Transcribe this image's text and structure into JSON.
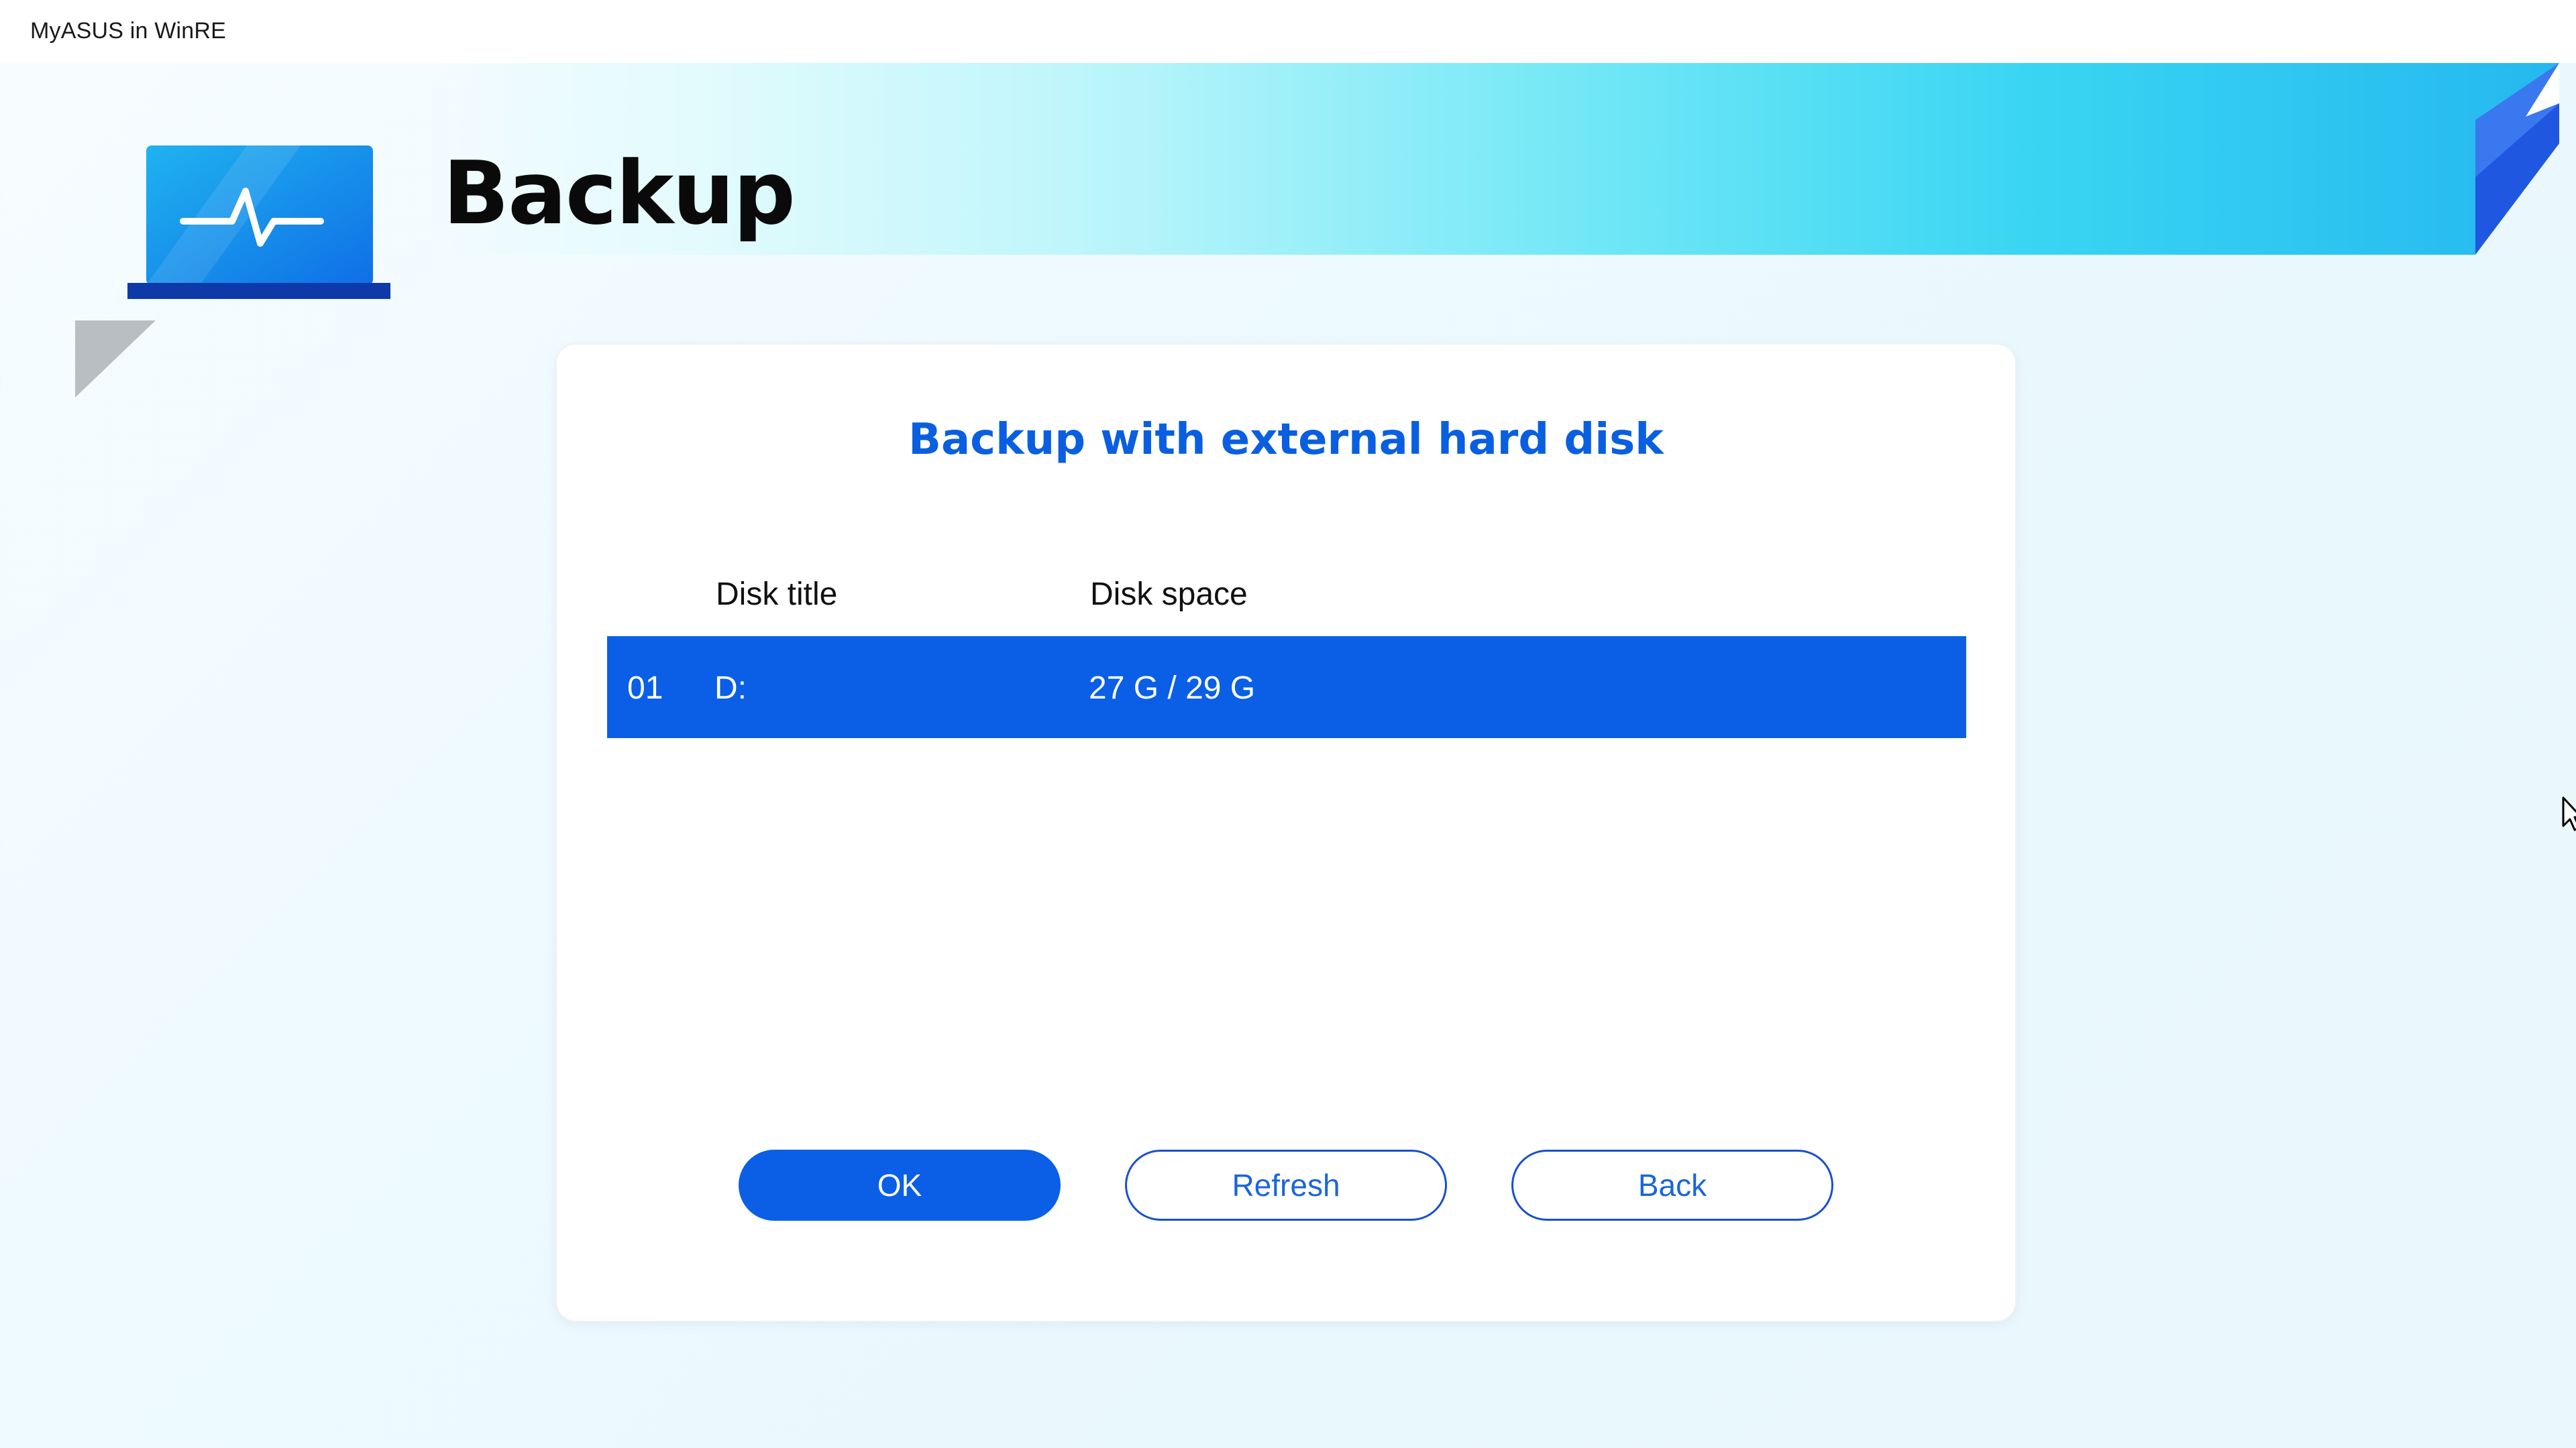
{
  "window": {
    "title": "MyASUS in WinRE"
  },
  "header": {
    "title": "Backup",
    "logo_icon": "laptop-heartbeat-icon"
  },
  "dialog": {
    "title": "Backup with external hard disk",
    "columns": [
      "Disk title",
      "Disk space"
    ],
    "disks": [
      {
        "index": "01",
        "title": "D:",
        "space": "27 G / 29 G",
        "selected": true
      }
    ],
    "buttons": {
      "ok": "OK",
      "refresh": "Refresh",
      "back": "Back"
    }
  },
  "colors": {
    "accent": "#0a5fe6",
    "title_blue": "#0a5fe0",
    "banner_cyan": "#3ad5f3"
  }
}
